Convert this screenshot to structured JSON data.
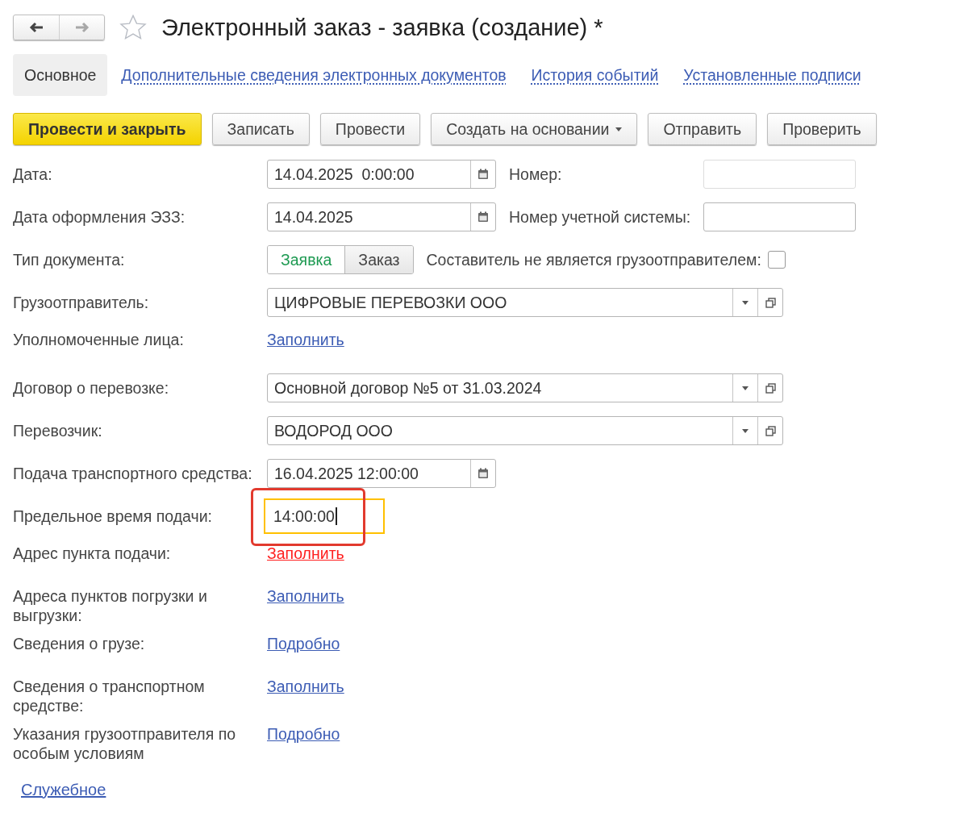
{
  "nav": {
    "back_disabled": false,
    "forward_disabled": true
  },
  "title": "Электронный заказ - заявка (создание) *",
  "tabs": [
    {
      "label": "Основное",
      "selected": true
    },
    {
      "label": "Дополнительные сведения электронных документов",
      "selected": false
    },
    {
      "label": "История событий",
      "selected": false
    },
    {
      "label": "Установленные подписи",
      "selected": false
    }
  ],
  "toolbar": [
    {
      "label": "Провести и закрыть",
      "default": true,
      "dropdown": false
    },
    {
      "label": "Записать",
      "default": false,
      "dropdown": false
    },
    {
      "label": "Провести",
      "default": false,
      "dropdown": false
    },
    {
      "label": "Создать на основании",
      "default": false,
      "dropdown": true
    },
    {
      "label": "Отправить",
      "default": false,
      "dropdown": false
    },
    {
      "label": "Проверить",
      "default": false,
      "dropdown": false
    }
  ],
  "rows": [
    {
      "label": "Дата:",
      "kind": "date",
      "value": "14.04.2025  0:00:00",
      "extra": {
        "label": "Номер:",
        "kind": "text",
        "disabled": true
      }
    },
    {
      "label": "Дата оформления ЭЗЗ:",
      "kind": "date",
      "value": "14.04.2025",
      "extra": {
        "label": "Номер учетной системы:",
        "kind": "text",
        "disabled": false
      }
    },
    {
      "label": "Тип документа:",
      "kind": "toggle",
      "options": [
        {
          "label": "Заявка",
          "selected": true
        },
        {
          "label": "Заказ",
          "selected": false
        }
      ],
      "extra": {
        "label": "Составитель не является грузоотправителем:",
        "kind": "checkbox",
        "checked": false
      }
    },
    {
      "label": "Грузоотправитель:",
      "kind": "select",
      "value": "ЦИФРОВЫЕ ПЕРЕВОЗКИ ООО"
    },
    {
      "label": "Уполномоченные лица:",
      "kind": "link",
      "value": "Заполнить",
      "required": false
    },
    {
      "label": "Договор о перевозке:",
      "kind": "select",
      "value": "Основной договор №5 от 31.03.2024"
    },
    {
      "label": "Перевозчик:",
      "kind": "select",
      "value": "ВОДОРОД ООО"
    },
    {
      "label": "Подача транспортного средства:",
      "kind": "date",
      "value": "16.04.2025 12:00:00"
    },
    {
      "label": "Предельное время подачи:",
      "kind": "time",
      "value": "14:00:00",
      "focused": true,
      "annotated": true
    },
    {
      "label": "Адрес пункта подачи:",
      "kind": "link",
      "value": "Заполнить",
      "required": true
    },
    {
      "label": "Адреса пунктов погрузки и выгрузки:",
      "kind": "link",
      "value": "Заполнить",
      "required": false
    },
    {
      "label": "Сведения о грузе:",
      "kind": "link",
      "value": "Подробно",
      "required": false
    },
    {
      "label": "Сведения о транспортном средстве:",
      "kind": "link",
      "value": "Заполнить",
      "required": false
    },
    {
      "label": "Указания грузоотправителя по особым условиям",
      "kind": "link",
      "value": "Подробно",
      "required": false
    }
  ],
  "footer_link": "Служебное"
}
